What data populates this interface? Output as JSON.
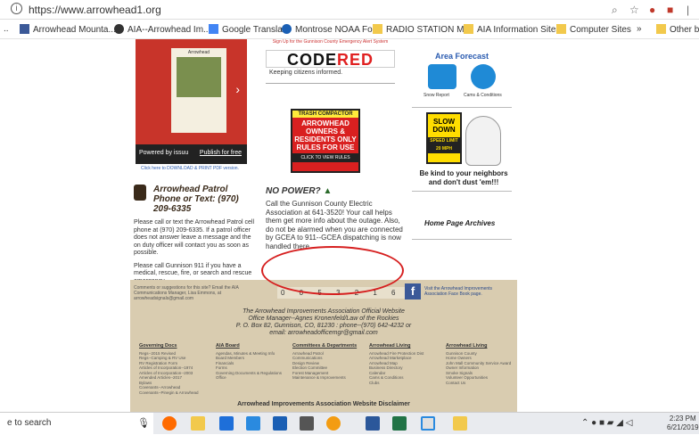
{
  "browser": {
    "url": "https://www.arrowhead1.org",
    "bookmarks": [
      "Arrowhead Mounta...",
      "AIA--Arrowhead Im...",
      "Google Translate",
      "Montrose NOAA Fo...",
      "RADIO STATION M...",
      "AIA Information Sites",
      "Computer Sites",
      "»",
      "Other boo"
    ]
  },
  "issuu": {
    "cover_title": "Arrowhead",
    "powered": "Powered by issuu",
    "publish": "Publish for free",
    "download": "Click here to DOWNLOAD & PRINT PDF version."
  },
  "codered": {
    "signup": "Sign Up for the Gunnison County Emergency Alert System",
    "logo_left": "CODE",
    "logo_right": "RED",
    "tagline": "Keeping citizens informed."
  },
  "trash": {
    "head": "TRASH COMPACTOR",
    "body": "ARROWHEAD OWNERS & RESIDENTS ONLY RULES FOR USE",
    "foot": "CLICK TO VIEW RULES"
  },
  "right": {
    "area_forecast": "Area Forecast",
    "snow": "Snow Report",
    "cams": "Cams & Conditions",
    "slow_sign": "SLOW DOWN",
    "speed": "SPEED LIMIT 20 MPH",
    "kind": "Be kind to your neighbors and don't dust 'em!!!",
    "archives": "Home Page Archives"
  },
  "patrol": {
    "title": "Arrowhead Patrol",
    "phone": "Phone or Text: (970) 209-6335",
    "p1": "Please call or text the Arrowhead Patrol cell phone at (970) 209-6335. If a patrol officer does not answer leave a message and the on duty officer will contact you as soon as possible.",
    "p2": "Please call Gunnison 911 if you have a medical, rescue, fire, or search and rescue emergency."
  },
  "nopower": {
    "title": "NO POWER?",
    "text": "Call the Gunnison County Electric Association at 641-3520! Your call helps them get more info about the outage. Also, do not be alarmed when you are connected by GCEA to 911--GCEA dispatching is now handled there."
  },
  "footer": {
    "comments": "Comments or suggestions for this site? Email the AIA Communications Manager, Lisa Emmons, at arrowheadsignals@gmail.com",
    "counter": "0 0 5 3 2 1 6",
    "fb_text": "Visit the Arrowhead Improvements Association Face Book page.",
    "official": "The Arrowhead Improvements Association Official Website",
    "manager": "Office Manager--Agnes Kronenfeld/Law of the Rockies",
    "address": "P. O. Box 82, Gunnison, CO, 81230 : phone--(970) 642-4232 or",
    "email": "email: arrowheadofficemgr@gmail.com",
    "columns": [
      {
        "head": "Governing Docs",
        "items": [
          "Regs--2015 Revised",
          "Regs--Camping & RV Use",
          "RV Registration Form",
          "Articles of Incorporation--1974",
          "Articles of Incorporation--2003",
          "Amended Articles--2017",
          "Bylaws",
          "Covenants--Arrowhead",
          "Covenants--Pinegin & Arrowhead"
        ]
      },
      {
        "head": "AIA Board",
        "items": [
          "Agendas, Minutes & Meeting Info",
          "Board Members",
          "Financials",
          "Forms",
          "Governing Documents & Regulations",
          "Office"
        ]
      },
      {
        "head": "Committees & Departments",
        "items": [
          "Arrowhead Patrol",
          "Communications",
          "Design Review",
          "Election Committee",
          "Forest Management",
          "Maintenance & Improvements"
        ]
      },
      {
        "head": "Arrowhead Living",
        "items": [
          "Arrowhead Fire Protection Dist",
          "Arrowhead Marketplace",
          "Arrowhead Map",
          "Business Directory",
          "Calendar",
          "Cams & Conditions",
          "Clubs"
        ]
      },
      {
        "head": "Arrowhead Living",
        "items": [
          "Gunnison County",
          "Home Owners",
          "John Mall Community Service Award",
          "Owner Information",
          "Smoke Signals",
          "Volunteer Opportunities",
          "Contact Us"
        ]
      }
    ],
    "disclaimer": "Arrowhead Improvements Association Website Disclaimer"
  },
  "taskbar": {
    "search": "e to search",
    "time": "2:23 PM",
    "date": "6/21/2019"
  }
}
